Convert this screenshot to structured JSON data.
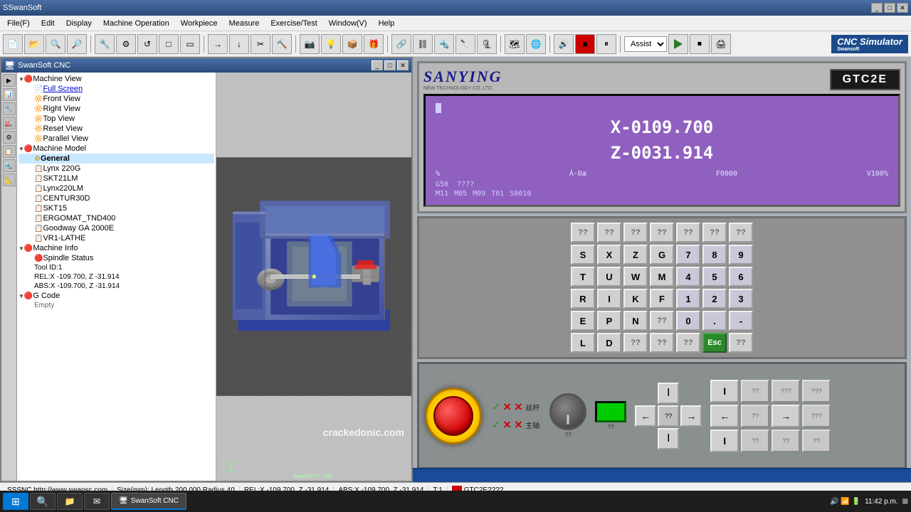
{
  "window": {
    "title": "SSwanSoft",
    "cnc_title": "SwanSoft CNC"
  },
  "menubar": {
    "items": [
      "File(F)",
      "Edit",
      "Display",
      "Machine Operation",
      "Workpiece",
      "Measure",
      "Exercise/Test",
      "Window(V)",
      "Help"
    ]
  },
  "toolbar": {
    "assist_label": "Assist",
    "logo_text": "CNC Simulator",
    "logo_sub": "Swansoft"
  },
  "tree": {
    "machine_view": "Machine View",
    "full_screen": "Full Screen",
    "front_view": "Front View",
    "right_view": "Right View",
    "top_view": "Top View",
    "reset_view": "Reset View",
    "parallel_view": "Parallel View",
    "machine_model": "Machine Model",
    "general": "General",
    "lynx220g": "Lynx 220G",
    "skt21lm": "SKT21LM",
    "lynx220lm": "Lynx220LM",
    "centur30d": "CENTUR30D",
    "skt15": "SKT15",
    "ergomat_tnd400": "ERGOMAT_TND400",
    "goodway_ga": "Goodway GA 2000E",
    "vr1_lathe": "VR1-LATHE",
    "machine_info": "Machine Info",
    "spindle_status": "Spindle Status",
    "tool_id": "Tool ID:1",
    "rel_coords": "REL:X -109.700, Z -31.914",
    "abs_coords": "ABS:X -109.700, Z -31.914",
    "g_code": "G Code",
    "empty": "Empty"
  },
  "display": {
    "brand": "SANYING",
    "brand_sub": "NEW TECHNOLOGY CO.,LTD.",
    "model": "GTC2E",
    "x_coord": "X-0109.700",
    "z_coord": "Z-0031.914",
    "percent": "%",
    "feed_mode": "Á-Ðæ",
    "f_value": "F0000",
    "v_value": "V100%",
    "g50": "G50",
    "qmarks1": "????",
    "m11": "M11",
    "m05": "M05",
    "m09": "M09",
    "t01": "T01",
    "s0010": "S0010"
  },
  "keypad": {
    "row1": [
      "??",
      "??",
      "??",
      "??",
      "??",
      "??",
      "??"
    ],
    "row2": [
      "S",
      "X",
      "Z",
      "G",
      "7",
      "8",
      "9"
    ],
    "row3": [
      "T",
      "U",
      "W",
      "M",
      "4",
      "5",
      "6"
    ],
    "row4": [
      "R",
      "I",
      "K",
      "F",
      "1",
      "2",
      "3"
    ],
    "row5": [
      "E",
      "P",
      "N",
      "??",
      "0",
      ".",
      "-"
    ],
    "row6": [
      "L",
      "D",
      "??",
      "??",
      "??",
      "Esc",
      "??"
    ]
  },
  "control_panel": {
    "switch_labels": [
      "丝杆",
      "主轴"
    ],
    "knob_label1": "??",
    "knob_label2": "??",
    "green_label": "??",
    "arrow_labels": {
      "up": "↑",
      "down": "↓",
      "left": "←",
      "right": "→",
      "center": "??"
    },
    "right_buttons": [
      "I",
      "??",
      "???",
      "???",
      "—",
      "??",
      "—",
      "???",
      "I",
      "??",
      "??",
      "??",
      "??",
      "??"
    ]
  },
  "statusbar": {
    "website": "SSSNC http://www.swansc.com",
    "size_info": "Size(mm): Length 200.000 Radius 40",
    "rel_coords": "REL:X -109.700, Z -31.914",
    "abs_coords": "ABS:X -109.700, Z -31.914",
    "tool": "T:1",
    "model": "GTC2E????",
    "time": "11:42 p.m.",
    "date": "⊞"
  },
  "taskbar": {
    "start": "⊞",
    "search": "🔍",
    "apps": [
      "⊞",
      "🔍",
      "📁",
      "✉",
      "🎵"
    ],
    "active_app": "SwanSoft CNC",
    "time": "11:42 p.m."
  },
  "watermark": "crackedonic.com"
}
